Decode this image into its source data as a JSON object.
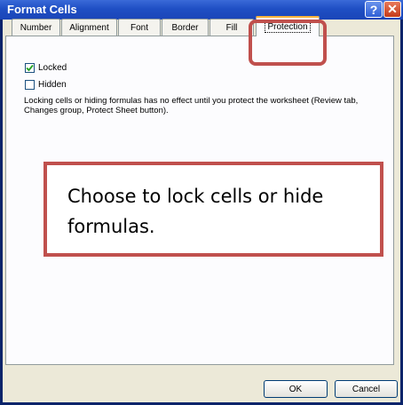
{
  "window": {
    "title": "Format Cells",
    "help_glyph": "?",
    "close_glyph": "✕"
  },
  "tabs": [
    {
      "label": "Number",
      "active": false
    },
    {
      "label": "Alignment",
      "active": false
    },
    {
      "label": "Font",
      "active": false
    },
    {
      "label": "Border",
      "active": false
    },
    {
      "label": "Fill",
      "active": false
    },
    {
      "label": "Protection",
      "active": true
    }
  ],
  "protection": {
    "locked": {
      "label": "Locked",
      "checked": true
    },
    "hidden": {
      "label": "Hidden",
      "checked": false
    },
    "info": "Locking cells or hiding formulas has no effect until you protect the worksheet (Review tab, Changes group, Protect Sheet button)."
  },
  "callout": {
    "text": "Choose to lock cells or hide formulas."
  },
  "buttons": {
    "ok": "OK",
    "cancel": "Cancel"
  },
  "colors": {
    "title_bar": "#1f4fc4",
    "dialog_bg": "#ece9d8",
    "active_tab_accent": "#f9b43c",
    "annotation": "#c0504d"
  },
  "icons": {
    "help": "help-icon",
    "close": "close-icon",
    "check": "checkmark-icon"
  }
}
